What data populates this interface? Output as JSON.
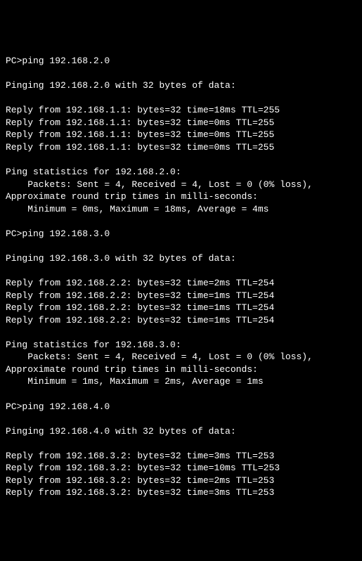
{
  "terminal": {
    "prompt": "PC>",
    "content": "PC>ping 192.168.2.0\n\nPinging 192.168.2.0 with 32 bytes of data:\n\nReply from 192.168.1.1: bytes=32 time=18ms TTL=255\nReply from 192.168.1.1: bytes=32 time=0ms TTL=255\nReply from 192.168.1.1: bytes=32 time=0ms TTL=255\nReply from 192.168.1.1: bytes=32 time=0ms TTL=255\n\nPing statistics for 192.168.2.0:\n    Packets: Sent = 4, Received = 4, Lost = 0 (0% loss),\nApproximate round trip times in milli-seconds:\n    Minimum = 0ms, Maximum = 18ms, Average = 4ms\n\nPC>ping 192.168.3.0\n\nPinging 192.168.3.0 with 32 bytes of data:\n\nReply from 192.168.2.2: bytes=32 time=2ms TTL=254\nReply from 192.168.2.2: bytes=32 time=1ms TTL=254\nReply from 192.168.2.2: bytes=32 time=1ms TTL=254\nReply from 192.168.2.2: bytes=32 time=1ms TTL=254\n\nPing statistics for 192.168.3.0:\n    Packets: Sent = 4, Received = 4, Lost = 0 (0% loss),\nApproximate round trip times in milli-seconds:\n    Minimum = 1ms, Maximum = 2ms, Average = 1ms\n\nPC>ping 192.168.4.0\n\nPinging 192.168.4.0 with 32 bytes of data:\n\nReply from 192.168.3.2: bytes=32 time=3ms TTL=253\nReply from 192.168.3.2: bytes=32 time=10ms TTL=253\nReply from 192.168.3.2: bytes=32 time=2ms TTL=253\nReply from 192.168.3.2: bytes=32 time=3ms TTL=253"
  },
  "commands": [
    {
      "command": "ping 192.168.2.0",
      "target": "192.168.2.0",
      "bytes": 32,
      "replies": [
        {
          "from": "192.168.1.1",
          "bytes": 32,
          "time_ms": 18,
          "ttl": 255
        },
        {
          "from": "192.168.1.1",
          "bytes": 32,
          "time_ms": 0,
          "ttl": 255
        },
        {
          "from": "192.168.1.1",
          "bytes": 32,
          "time_ms": 0,
          "ttl": 255
        },
        {
          "from": "192.168.1.1",
          "bytes": 32,
          "time_ms": 0,
          "ttl": 255
        }
      ],
      "statistics": {
        "sent": 4,
        "received": 4,
        "lost": 0,
        "loss_percent": 0,
        "min_ms": 0,
        "max_ms": 18,
        "avg_ms": 4
      }
    },
    {
      "command": "ping 192.168.3.0",
      "target": "192.168.3.0",
      "bytes": 32,
      "replies": [
        {
          "from": "192.168.2.2",
          "bytes": 32,
          "time_ms": 2,
          "ttl": 254
        },
        {
          "from": "192.168.2.2",
          "bytes": 32,
          "time_ms": 1,
          "ttl": 254
        },
        {
          "from": "192.168.2.2",
          "bytes": 32,
          "time_ms": 1,
          "ttl": 254
        },
        {
          "from": "192.168.2.2",
          "bytes": 32,
          "time_ms": 1,
          "ttl": 254
        }
      ],
      "statistics": {
        "sent": 4,
        "received": 4,
        "lost": 0,
        "loss_percent": 0,
        "min_ms": 1,
        "max_ms": 2,
        "avg_ms": 1
      }
    },
    {
      "command": "ping 192.168.4.0",
      "target": "192.168.4.0",
      "bytes": 32,
      "replies": [
        {
          "from": "192.168.3.2",
          "bytes": 32,
          "time_ms": 3,
          "ttl": 253
        },
        {
          "from": "192.168.3.2",
          "bytes": 32,
          "time_ms": 10,
          "ttl": 253
        },
        {
          "from": "192.168.3.2",
          "bytes": 32,
          "time_ms": 2,
          "ttl": 253
        },
        {
          "from": "192.168.3.2",
          "bytes": 32,
          "time_ms": 3,
          "ttl": 253
        }
      ]
    }
  ]
}
